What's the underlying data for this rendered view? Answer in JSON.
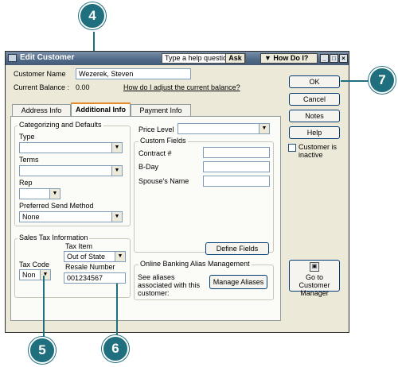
{
  "window": {
    "title": "Edit Customer",
    "help_placeholder": "Type a help question",
    "ask_label": "Ask",
    "howdoi_label": "How Do I?",
    "minimize": "_",
    "maximize": "□",
    "close": "×"
  },
  "customer": {
    "name_label": "Customer Name",
    "name_value": "Wezerek, Steven",
    "balance_label": "Current Balance :",
    "balance_value": "0.00",
    "balance_link": "How do I adjust the current balance?"
  },
  "tabs": [
    {
      "label": "Address Info"
    },
    {
      "label": "Additional Info"
    },
    {
      "label": "Payment Info"
    }
  ],
  "categorizing": {
    "legend": "Categorizing and Defaults",
    "type_label": "Type",
    "type_value": "",
    "terms_label": "Terms",
    "terms_value": "",
    "rep_label": "Rep",
    "rep_value": "",
    "send_method_label": "Preferred Send Method",
    "send_method_value": "None"
  },
  "sales_tax": {
    "legend": "Sales Tax Information",
    "tax_item_label": "Tax Item",
    "tax_item_value": "Out of State",
    "tax_code_label": "Tax Code",
    "tax_code_value": "Non",
    "resale_label": "Resale Number",
    "resale_value": "001234567"
  },
  "price_level": {
    "label": "Price Level",
    "value": ""
  },
  "custom_fields": {
    "legend": "Custom Fields",
    "fields": [
      {
        "label": "Contract #",
        "value": ""
      },
      {
        "label": "B-Day",
        "value": ""
      },
      {
        "label": "Spouse's Name",
        "value": ""
      }
    ],
    "define_button": "Define Fields"
  },
  "banking": {
    "legend": "Online Banking Alias Management",
    "description": "See aliases associated with this customer:",
    "manage_button": "Manage Aliases"
  },
  "side": {
    "ok": "OK",
    "cancel": "Cancel",
    "notes": "Notes",
    "help": "Help",
    "inactive_label": "Customer is inactive",
    "goto_label": "Go to Customer Manager"
  },
  "callouts": [
    "4",
    "5",
    "6",
    "7"
  ],
  "colors": {
    "callout": "#1f6f7e",
    "title_bar": "#4f6987",
    "dialog_bg": "#ece9d8"
  }
}
